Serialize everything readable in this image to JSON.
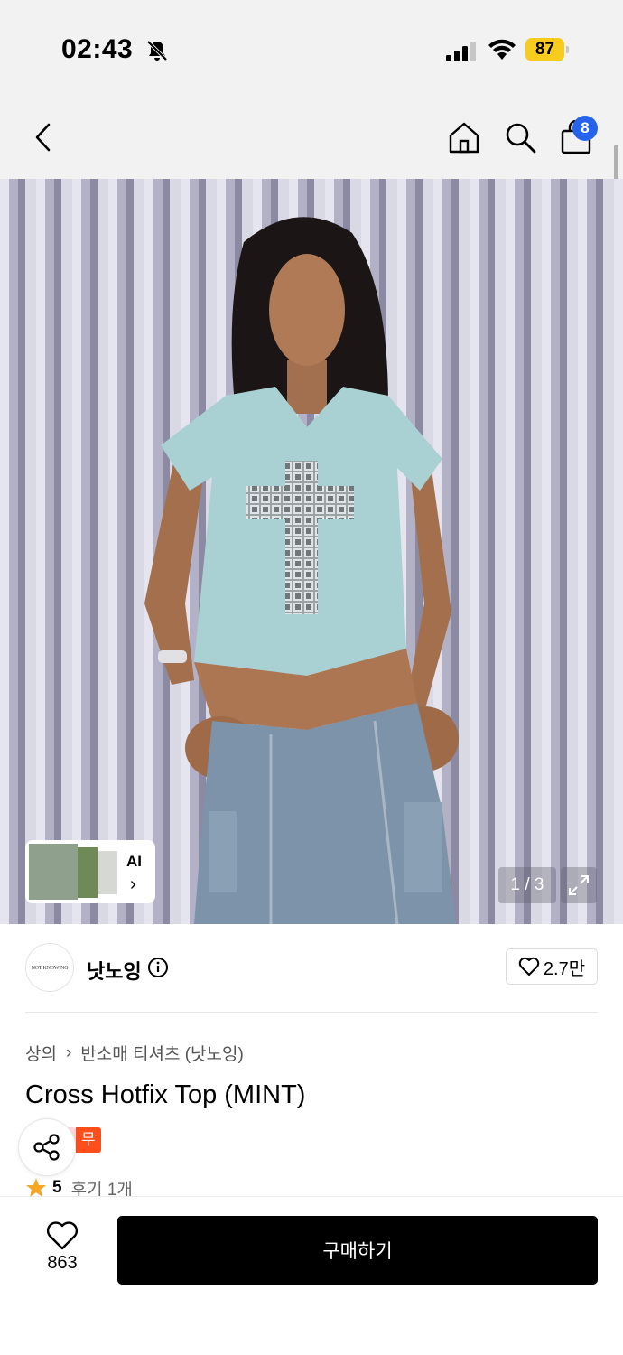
{
  "status_bar": {
    "time": "02:43",
    "battery": "87",
    "icons": [
      "bell-slash-icon",
      "signal-icon",
      "wifi-icon",
      "battery-icon"
    ]
  },
  "nav": {
    "icons": [
      "back-arrow-icon",
      "home-icon",
      "search-icon",
      "shopping-bag-icon"
    ],
    "cart_count": "8"
  },
  "gallery": {
    "thumbnail_label": "AI",
    "page_indicator": "1 / 3",
    "expand_icon": "expand-icon"
  },
  "brand": {
    "logo_text": "NOT KNOWING",
    "name": "낫노잉",
    "likes": "2.7만"
  },
  "product": {
    "breadcrumb": [
      "상의",
      "반소매 티셔츠 (낫노잉)"
    ],
    "title": "Cross Hotfix Top (MINT)",
    "badge": "무진장",
    "rating": "5",
    "reviews": "후기 1개"
  },
  "bottom": {
    "wish_count": "863",
    "buy_label": "구매하기"
  },
  "colors": {
    "accent_blue": "#2563eb",
    "badge_orange": "#ff4d1c",
    "star": "#f5a623",
    "battery": "#f7cc1f"
  }
}
